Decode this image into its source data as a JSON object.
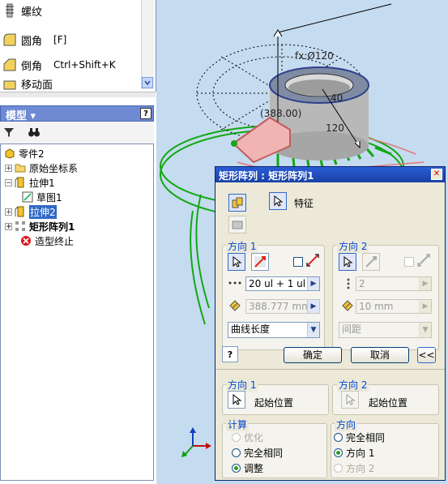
{
  "command_panel": {
    "items": [
      {
        "label": "螺纹",
        "shortcut": ""
      },
      {
        "label": "圆角",
        "shortcut": "[F]"
      },
      {
        "label": "倒角",
        "shortcut": "Ctrl+Shift+K"
      },
      {
        "label": "移动面",
        "shortcut": ""
      }
    ]
  },
  "model_panel": {
    "title": "模型 ▾",
    "help": "?",
    "tree": [
      {
        "label": "零件2"
      },
      {
        "label": "原始坐标系"
      },
      {
        "label": "拉伸1"
      },
      {
        "label": "草图1"
      },
      {
        "label": "拉伸2"
      },
      {
        "label": "矩形阵列1"
      },
      {
        "label": "造型终止"
      }
    ]
  },
  "viewport": {
    "annotations": [
      "fx:Ø120",
      "40",
      "(388.00)",
      "120"
    ]
  },
  "dialog": {
    "title": "矩形阵列 : 矩形阵列1",
    "close": "✕",
    "feature_label": "特征",
    "direction1": {
      "title": "方向 1",
      "count": "20 ul + 1 ul",
      "spacing": "388.777 mm",
      "spacing_type": "曲线长度"
    },
    "direction2": {
      "title": "方向 2",
      "count": "2",
      "spacing": "10 mm",
      "spacing_type": "间距"
    },
    "ok": "确定",
    "cancel": "取消",
    "more": "<<",
    "help": "?",
    "start_dir1": {
      "title": "方向 1",
      "label": "起始位置"
    },
    "start_dir2": {
      "title": "方向 2",
      "label": "起始位置"
    },
    "compute": {
      "title": "计算",
      "options": [
        "优化",
        "完全相同",
        "调整"
      ],
      "selected": "调整"
    },
    "orientation": {
      "title": "方向",
      "options": [
        "完全相同",
        "方向 1",
        "方向 2"
      ],
      "selected": "方向 1"
    }
  },
  "colors": {
    "accent": "#0046d5",
    "title_bar": "#1941a5",
    "viewport_bg": "#c5dbef",
    "pattern_green": "#11a811",
    "pattern_red": "#e07b7b"
  }
}
